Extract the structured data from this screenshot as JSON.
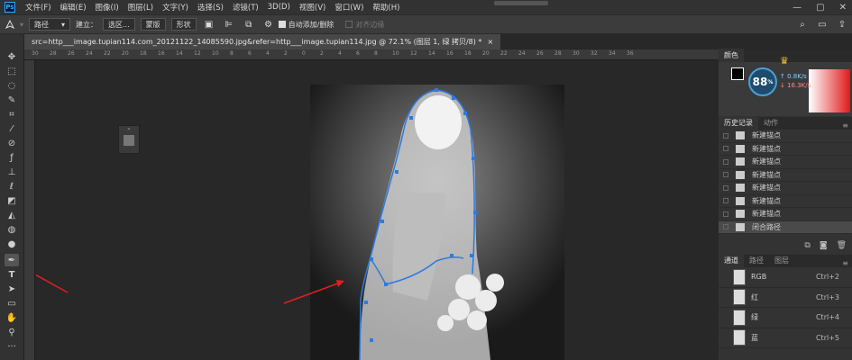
{
  "app": {
    "logo": "Ps"
  },
  "menu": [
    "文件(F)",
    "编辑(E)",
    "图像(I)",
    "图层(L)",
    "文字(Y)",
    "选择(S)",
    "滤镜(T)",
    "3D(D)",
    "视图(V)",
    "窗口(W)",
    "帮助(H)"
  ],
  "window_controls": {
    "minimize": "—",
    "maximize": "▢",
    "close": "✕"
  },
  "options": {
    "mode_value": "路径",
    "build_label": "建立：",
    "selection_btn": "选区...",
    "mask_btn": "蒙版",
    "shape_btn": "形状",
    "auto_add_label": "自动添加/删除",
    "align_edges_label": "对齐边缘"
  },
  "document": {
    "tab_title": "src=http___image.tupian114.com_20121122_14085590.jpg&refer=http___image.tupian114.jpg @ 72.1% (图层 1, 绿 拷贝/8) *",
    "close": "×"
  },
  "ruler_ticks": [
    "30",
    "28",
    "26",
    "24",
    "22",
    "20",
    "18",
    "16",
    "14",
    "12",
    "10",
    "8",
    "6",
    "4",
    "2",
    "0",
    "2",
    "4",
    "6",
    "8",
    "10",
    "12",
    "14",
    "16",
    "18",
    "20",
    "22",
    "24",
    "26",
    "28",
    "30",
    "32",
    "34",
    "36"
  ],
  "gauge": {
    "percent": "88",
    "unit": "%",
    "up": "0.8K/s",
    "down": "16.3K/s"
  },
  "color_tab": "颜色",
  "history": {
    "tabs": [
      "历史记录",
      "动作"
    ],
    "items": [
      "新建锚点",
      "新建锚点",
      "新建锚点",
      "新建锚点",
      "新建锚点",
      "新建锚点",
      "新建锚点",
      "闭合路径"
    ]
  },
  "channels": {
    "tabs": [
      "通道",
      "路径",
      "图层"
    ],
    "rows": [
      {
        "name": "RGB",
        "shortcut": "Ctrl+2"
      },
      {
        "name": "红",
        "shortcut": "Ctrl+3"
      },
      {
        "name": "绿",
        "shortcut": "Ctrl+4"
      },
      {
        "name": "蓝",
        "shortcut": "Ctrl+5"
      }
    ]
  },
  "colors": {
    "accent": "#2d7ae0",
    "arrow": "#e02020",
    "panel": "#323232"
  }
}
